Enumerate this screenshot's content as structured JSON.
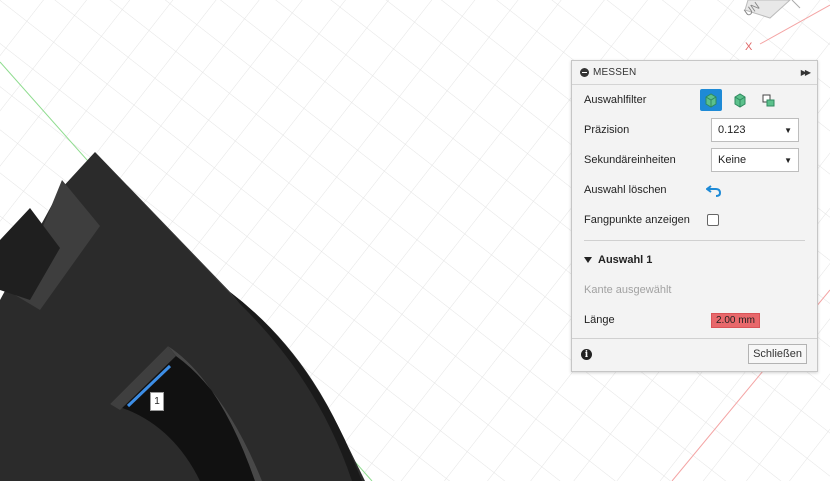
{
  "colors": {
    "accent": "#1e8ad6",
    "model": "#2b2b2b",
    "grid": "#e6e6e6",
    "axis_green": "#7fd67f",
    "axis_red": "#f0a0a0",
    "value_highlight": "#e8686b"
  },
  "viewcube": {
    "label": "UN",
    "axis_label": "X"
  },
  "edge_marker": "1",
  "panel": {
    "title": "MESSEN",
    "collapse_icon": "minus-circle-icon",
    "expand_icon": "fast-forward-icon",
    "selection_filter": {
      "label": "Auswahlfilter",
      "filters": [
        "body-filter-icon",
        "face-filter-icon",
        "edge-filter-icon"
      ],
      "active_index": 0
    },
    "precision": {
      "label": "Präzision",
      "value": "0.123"
    },
    "secondary_units": {
      "label": "Sekundäreinheiten",
      "value": "Keine"
    },
    "clear_selection": {
      "label": "Auswahl löschen",
      "icon": "undo-icon"
    },
    "snap_points": {
      "label": "Fangpunkte anzeigen",
      "checked": false
    },
    "section": {
      "title": "Auswahl 1",
      "status": "Kante ausgewählt",
      "length": {
        "label": "Länge",
        "value": "2.00 mm"
      }
    },
    "close_label": "Schließen"
  }
}
